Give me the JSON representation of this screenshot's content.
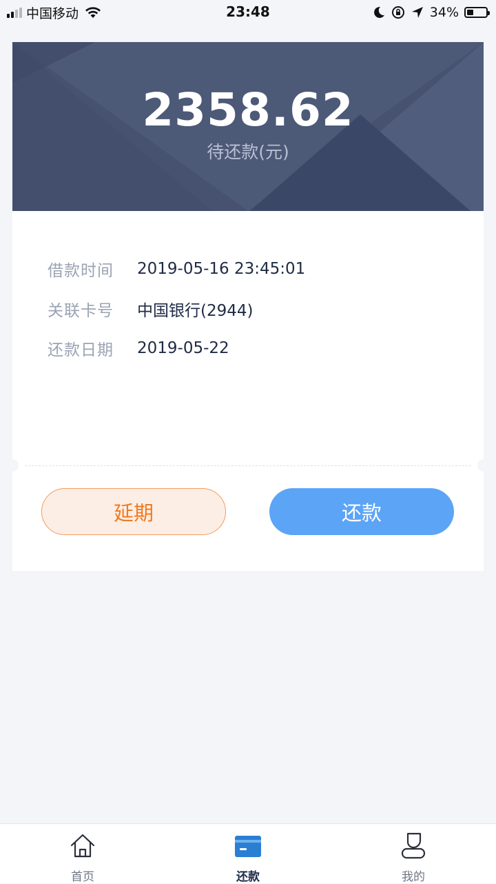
{
  "status_bar": {
    "carrier": "中国移动",
    "time": "23:48",
    "battery_percent": "34%",
    "battery_level": 0.34,
    "icons": [
      "signal-icon",
      "wifi-icon",
      "moon-icon",
      "rotation-lock-icon",
      "location-arrow-icon",
      "battery-icon"
    ]
  },
  "summary": {
    "amount": "2358.62",
    "label": "待还款(元)"
  },
  "details": [
    {
      "label": "借款时间",
      "value": "2019-05-16 23:45:01"
    },
    {
      "label": "关联卡号",
      "value": "中国银行(2944)"
    },
    {
      "label": "还款日期",
      "value": "2019-05-22"
    }
  ],
  "actions": {
    "extend_label": "延期",
    "repay_label": "还款"
  },
  "tabbar": {
    "items": [
      {
        "label": "首页",
        "icon": "home-icon",
        "active": false
      },
      {
        "label": "还款",
        "icon": "card-icon",
        "active": true
      },
      {
        "label": "我的",
        "icon": "profile-icon",
        "active": false
      }
    ]
  },
  "colors": {
    "hero_bg": "#46526f",
    "accent_blue": "#5ba4f6",
    "extend_orange": "#f07a20",
    "tab_active": "#2a7fd4"
  }
}
